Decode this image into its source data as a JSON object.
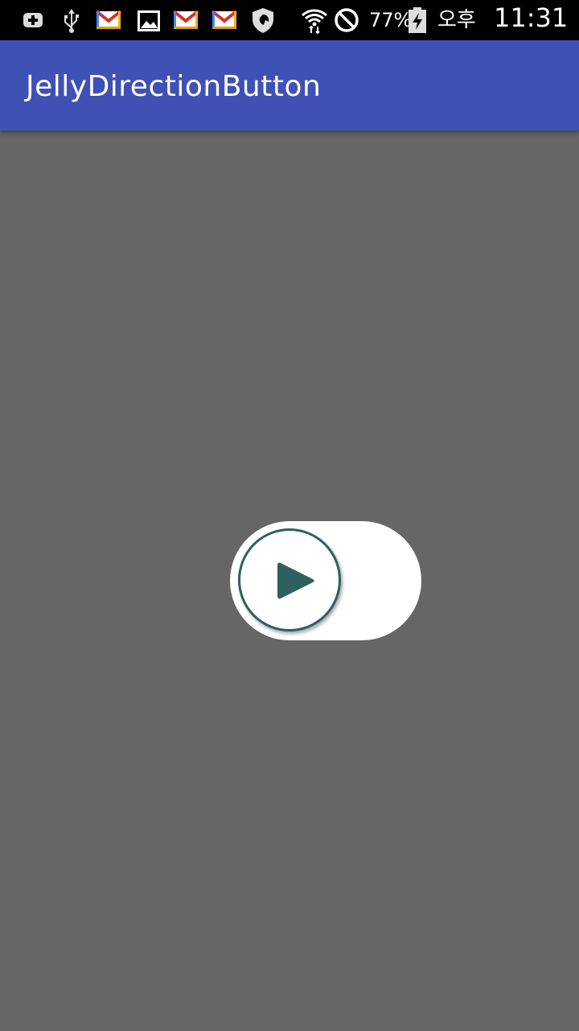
{
  "status_bar": {
    "battery_percent": "77%",
    "ampm": "오후",
    "time": "11:31",
    "icons": [
      "add-notification-icon",
      "usb-icon",
      "gmail-icon",
      "gallery-icon",
      "gmail-icon",
      "gmail-icon",
      "shield-icon",
      "wifi-icon",
      "blocked-icon",
      "battery-charging-icon"
    ]
  },
  "app_bar": {
    "title": "JellyDirectionButton",
    "color": "#3F51B5"
  },
  "content": {
    "background_color": "#666666",
    "jelly_button": {
      "icon": "play-icon",
      "track_color": "#ffffff",
      "accent_color": "#2c615e"
    }
  }
}
